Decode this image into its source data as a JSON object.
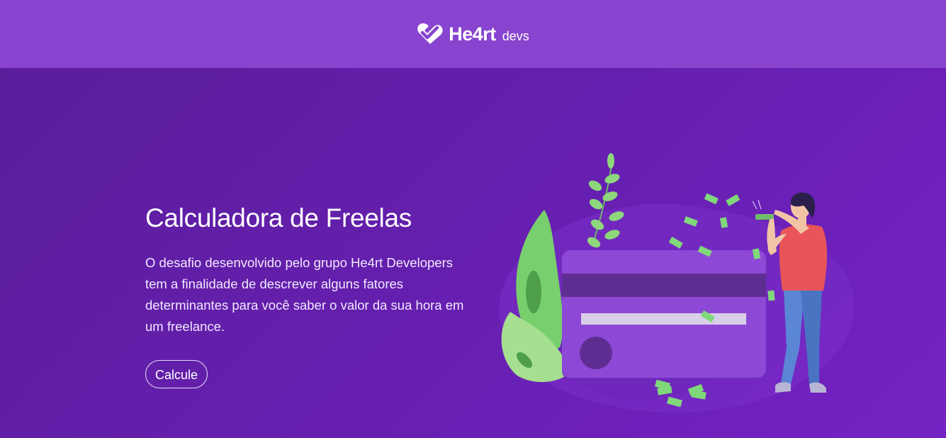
{
  "header": {
    "brand": "He4rt",
    "brand_sub": "devs",
    "logo_icon": "heart-check-logo-icon"
  },
  "hero": {
    "title": "Calculadora de Freelas",
    "description": "O desafio desenvolvido pelo grupo He4rt Developers tem a finalidade de descrever alguns fatores determinantes para você saber o valor da sua hora em um freelance.",
    "cta_label": "Calcule"
  },
  "illustration": {
    "icon": "credit-card-money-person-illustration"
  },
  "colors": {
    "header_bg": "#8844cf",
    "page_bg_start": "#5a1e99",
    "page_bg_end": "#7422c3",
    "money_green": "#6fd07a",
    "card_purple": "#8d49d6",
    "shirt_red": "#e8545a",
    "pants_blue": "#5b86d6"
  }
}
